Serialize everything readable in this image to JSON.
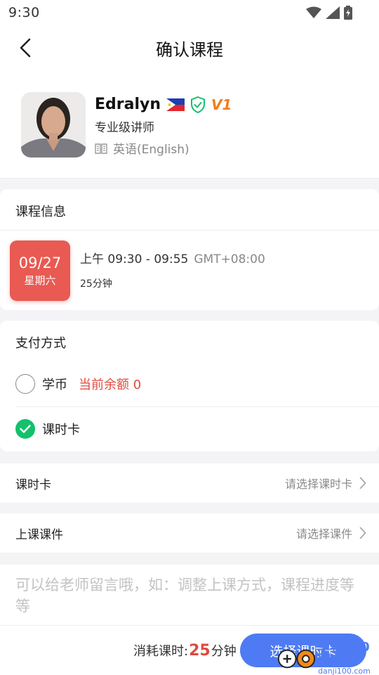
{
  "status_bar": {
    "time": "9:30"
  },
  "nav": {
    "title": "确认课程"
  },
  "teacher": {
    "name": "Edralyn",
    "title": "专业级讲师",
    "language": "英语(English)",
    "level_badge": "V1"
  },
  "course_info": {
    "section_title": "课程信息",
    "date": "09/27",
    "weekday": "星期六",
    "time_range": "上午 09:30 - 09:55",
    "timezone": "GMT+08:00",
    "duration": "25分钟"
  },
  "payment": {
    "section_title": "支付方式",
    "options": [
      {
        "label": "学币",
        "note": "当前余额 0",
        "selected": false
      },
      {
        "label": "课时卡",
        "selected": true
      }
    ]
  },
  "class_hour_card": {
    "label": "课时卡",
    "placeholder": "请选择课时卡"
  },
  "courseware": {
    "label": "上课课件",
    "placeholder": "请选择课件"
  },
  "message": {
    "placeholder": "可以给老师留言哦，如：调整上课方式，课程进度等等"
  },
  "footer": {
    "consume_prefix": "消耗课时:",
    "consume_value": "25",
    "consume_unit": "分钟",
    "button_label": "选择课时卡"
  },
  "watermark": {
    "text": "单机100网",
    "sub": "danji100.com"
  },
  "colors": {
    "accent": "#4e7bf3",
    "date_tile": "#e85a52",
    "check": "#13c16b",
    "balance": "#e04a3f"
  }
}
